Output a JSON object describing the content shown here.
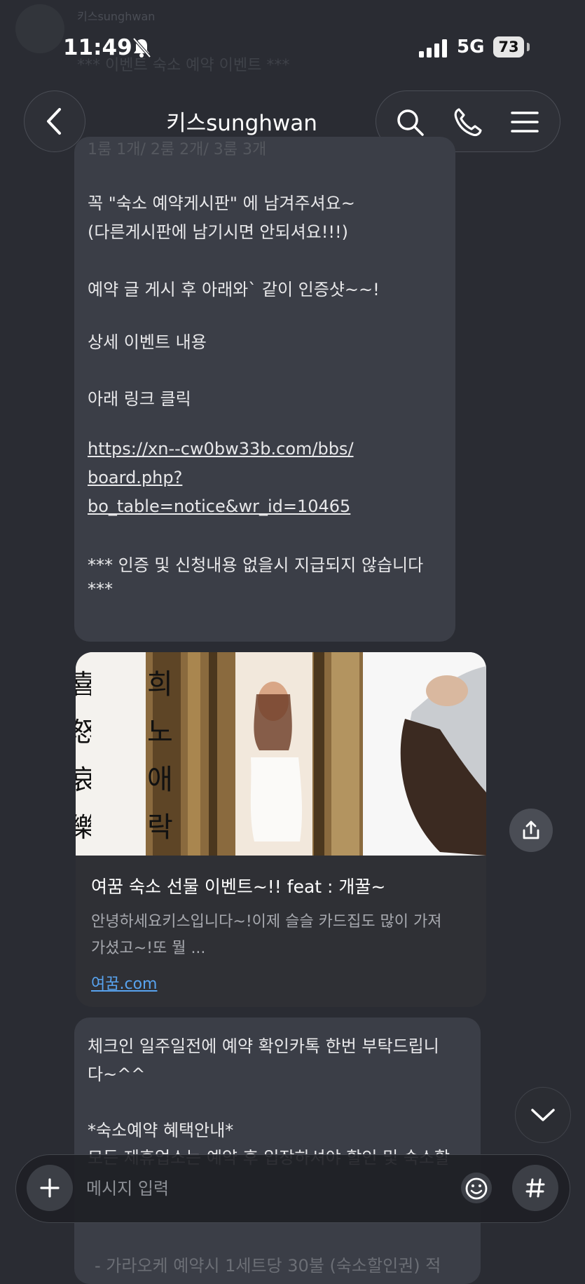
{
  "status_bar": {
    "time": "11:49",
    "network": "5G",
    "battery": "73"
  },
  "faded_top": {
    "sender": "키스sunghwan",
    "line": "*** 이벤트 숙소 예약 이벤트 ***"
  },
  "header": {
    "title": "키스sunghwan"
  },
  "bubble1": {
    "partial_top": "1룸 1개/ 2룸 2개/ 3룸 3개",
    "lines": [
      "꼭  \"숙소 예약게시판\" 에 남겨주셔요~",
      "(다른게시판에 남기시면 안되셔요!!!)",
      "예약 글 게시 후 아래와` 같이 인증샷~~!",
      "상세 이벤트 내용",
      "아래 링크 클릭",
      "*** 인증 및 신청내용 없을시 지급되지 않습니다",
      "***"
    ],
    "link_lines": [
      "https://xn--cw0bw33b.com/bbs/",
      "board.php?",
      "bo_table=notice&wr_id=10465"
    ]
  },
  "card": {
    "image_chars": [
      "희",
      "노",
      "애",
      "락"
    ],
    "image_chars_left": [
      "喜",
      "怒",
      "哀",
      "樂"
    ],
    "title": "여꿈 숙소 선물 이벤트~!! feat : 개꿀~",
    "desc_lines": [
      "안녕하세요키스입니다~!이제 슬슬 카드집도 많이 가져",
      "가셨고~!또 뭘 ..."
    ],
    "domain": "여꿈.com"
  },
  "bubble2": {
    "lines": [
      "체크인 일주일전에 예약 확인카톡 한번 부탁드립니",
      "다~^^",
      "*숙소예약 혜택안내*",
      "모든 제휴업소는 예약 후 입장하셔야 할인 및 숙소할"
    ],
    "behind_line": "- 가라오케 예약시 1세트당 30불 (숙소할인권) 적"
  },
  "input": {
    "placeholder": "메시지 입력"
  }
}
